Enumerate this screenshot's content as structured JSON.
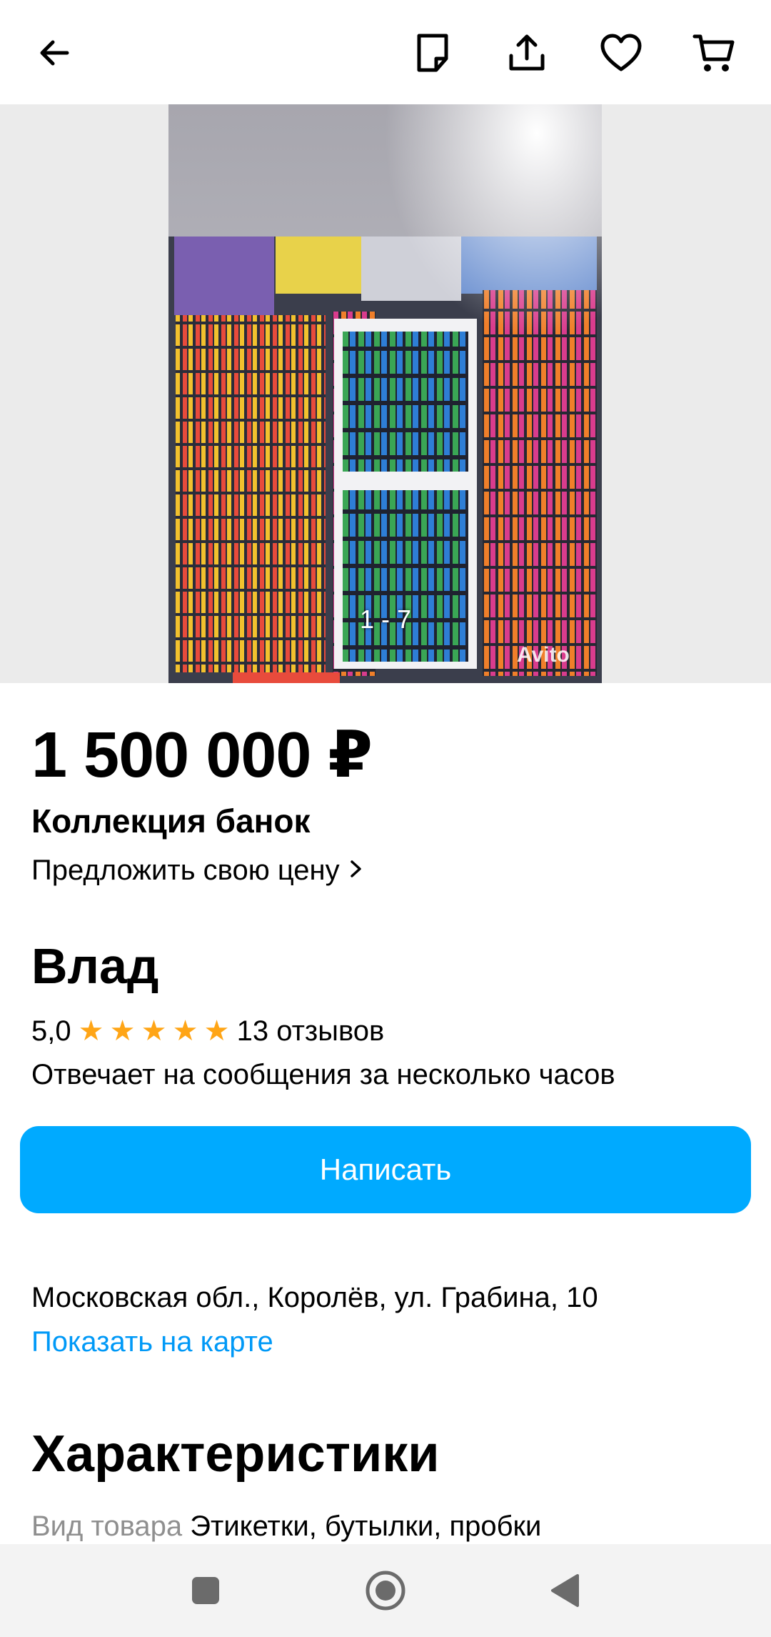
{
  "topbar": {
    "icons": [
      "back-arrow-icon",
      "note-icon",
      "share-icon",
      "heart-icon",
      "cart-icon"
    ]
  },
  "gallery": {
    "counter": "1 - 7",
    "watermark": "Avito"
  },
  "listing": {
    "price": "1 500 000 ₽",
    "title": "Коллекция банок",
    "offer_price": "Предложить свою цену"
  },
  "seller": {
    "name": "Влад",
    "rating": "5,0",
    "stars": 5,
    "reviews": "13 отзывов",
    "reply_time": "Отвечает на сообщения за несколько часов"
  },
  "actions": {
    "write_label": "Написать"
  },
  "location": {
    "address": "Московская обл., Королёв, ул. Грабина, 10",
    "map_link": "Показать на карте"
  },
  "characteristics": {
    "heading": "Характеристики",
    "rows": [
      {
        "key": "Вид товара",
        "value": "Этикетки, бутылки, пробки"
      }
    ]
  },
  "colors": {
    "accent": "#00aaff",
    "link": "#0099f7",
    "star": "#ffa516"
  }
}
